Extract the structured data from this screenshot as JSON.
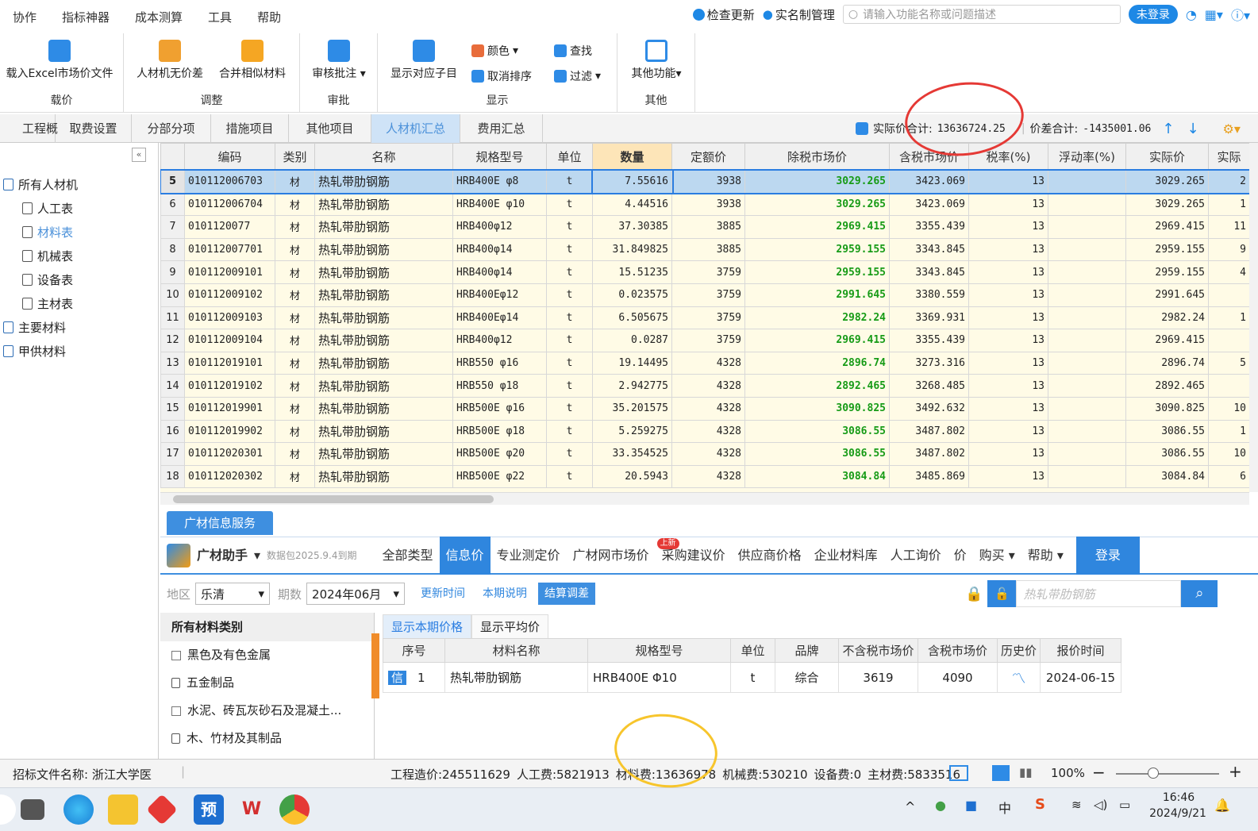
{
  "menu": {
    "items": [
      "协作",
      "指标神器",
      "成本测算",
      "工具",
      "帮助"
    ],
    "check_update": "检查更新",
    "realname": "实名制管理",
    "search_placeholder": "请输入功能名称或问题描述",
    "login_state": "未登录"
  },
  "ribbon": {
    "groups": [
      {
        "title": "载价",
        "buttons": [
          "载入Excel市场价文件"
        ]
      },
      {
        "title": "调整",
        "buttons": [
          "人材机无价差",
          "合并相似材料"
        ]
      },
      {
        "title": "审批",
        "buttons": [
          "审核批注"
        ]
      },
      {
        "title": "显示",
        "buttons": [
          "显示对应子目",
          "颜色",
          "取消排序",
          "查找",
          "过滤"
        ]
      },
      {
        "title": "其他",
        "buttons": [
          "其他功能"
        ]
      }
    ]
  },
  "tabs": [
    "工程概况",
    "取费设置",
    "分部分项",
    "措施项目",
    "其他项目",
    "人材机汇总",
    "费用汇总"
  ],
  "summary": {
    "actual_total_label": "实际价合计:",
    "actual_total": "13636724.25",
    "diff_label": "价差合计:",
    "diff_total": "-1435001.06"
  },
  "tree": {
    "root": "所有人材机",
    "children": [
      "人工表",
      "材料表",
      "机械表",
      "设备表",
      "主材表"
    ],
    "others": [
      "主要材料",
      "甲供材料"
    ]
  },
  "grid": {
    "headers": [
      "编码",
      "类别",
      "名称",
      "规格型号",
      "单位",
      "数量",
      "定额价",
      "除税市场价",
      "含税市场价",
      "税率(%)",
      "浮动率(%)",
      "实际价",
      "实际"
    ],
    "rows": [
      [
        "5",
        "010112006703",
        "材",
        "热轧带肋钢筋",
        "HRB400E φ8",
        "t",
        "7.55616",
        "3938",
        "3029.265",
        "3423.069",
        "13",
        "",
        "3029.265",
        "2"
      ],
      [
        "6",
        "010112006704",
        "材",
        "热轧带肋钢筋",
        "HRB400E φ10",
        "t",
        "4.44516",
        "3938",
        "3029.265",
        "3423.069",
        "13",
        "",
        "3029.265",
        "1"
      ],
      [
        "7",
        "0101120077",
        "材",
        "热轧带肋钢筋",
        "HRB400φ12",
        "t",
        "37.30385",
        "3885",
        "2969.415",
        "3355.439",
        "13",
        "",
        "2969.415",
        "11"
      ],
      [
        "8",
        "010112007701",
        "材",
        "热轧带肋钢筋",
        "HRB400φ14",
        "t",
        "31.849825",
        "3885",
        "2959.155",
        "3343.845",
        "13",
        "",
        "2959.155",
        "9"
      ],
      [
        "9",
        "010112009101",
        "材",
        "热轧带肋钢筋",
        "HRB400φ14",
        "t",
        "15.51235",
        "3759",
        "2959.155",
        "3343.845",
        "13",
        "",
        "2959.155",
        "4"
      ],
      [
        "10",
        "010112009102",
        "材",
        "热轧带肋钢筋",
        "HRB400Eφ12",
        "t",
        "0.023575",
        "3759",
        "2991.645",
        "3380.559",
        "13",
        "",
        "2991.645",
        ""
      ],
      [
        "11",
        "010112009103",
        "材",
        "热轧带肋钢筋",
        "HRB400Eφ14",
        "t",
        "6.505675",
        "3759",
        "2982.24",
        "3369.931",
        "13",
        "",
        "2982.24",
        "1"
      ],
      [
        "12",
        "010112009104",
        "材",
        "热轧带肋钢筋",
        "HRB400φ12",
        "t",
        "0.0287",
        "3759",
        "2969.415",
        "3355.439",
        "13",
        "",
        "2969.415",
        ""
      ],
      [
        "13",
        "010112019101",
        "材",
        "热轧带肋钢筋",
        "HRB550 φ16",
        "t",
        "19.14495",
        "4328",
        "2896.74",
        "3273.316",
        "13",
        "",
        "2896.74",
        "5"
      ],
      [
        "14",
        "010112019102",
        "材",
        "热轧带肋钢筋",
        "HRB550 φ18",
        "t",
        "2.942775",
        "4328",
        "2892.465",
        "3268.485",
        "13",
        "",
        "2892.465",
        ""
      ],
      [
        "15",
        "010112019901",
        "材",
        "热轧带肋钢筋",
        "HRB500E φ16",
        "t",
        "35.201575",
        "4328",
        "3090.825",
        "3492.632",
        "13",
        "",
        "3090.825",
        "10"
      ],
      [
        "16",
        "010112019902",
        "材",
        "热轧带肋钢筋",
        "HRB500E φ18",
        "t",
        "5.259275",
        "4328",
        "3086.55",
        "3487.802",
        "13",
        "",
        "3086.55",
        "1"
      ],
      [
        "17",
        "010112020301",
        "材",
        "热轧带肋钢筋",
        "HRB500E φ20",
        "t",
        "33.354525",
        "4328",
        "3086.55",
        "3487.802",
        "13",
        "",
        "3086.55",
        "10"
      ],
      [
        "18",
        "010112020302",
        "材",
        "热轧带肋钢筋",
        "HRB500E φ22",
        "t",
        "20.5943",
        "4328",
        "3084.84",
        "3485.869",
        "13",
        "",
        "3084.84",
        "6"
      ]
    ]
  },
  "gc": {
    "tab": "广材信息服务",
    "brand": "广材助手",
    "expiry": "数据包2025.9.4到期",
    "nav": [
      "全部类型",
      "信息价",
      "专业测定价",
      "广材网市场价",
      "采购建议价",
      "供应商价格",
      "企业材料库",
      "人工询价",
      "价",
      "购买",
      "帮助",
      "登录"
    ],
    "badge": "上新",
    "region_label": "地区",
    "region": "乐清",
    "period_label": "期数",
    "period": "2024年06月",
    "btns": [
      "更新时间",
      "本期说明",
      "结算调差"
    ],
    "search_placeholder": "热轧带肋钢筋",
    "cat_head": "所有材料类别",
    "cats": [
      "黑色及有色金属",
      "五金制品",
      "水泥、砖瓦灰砂石及混凝土...",
      "木、竹材及其制品"
    ],
    "ptabs": [
      "显示本期价格",
      "显示平均价"
    ],
    "price_headers": [
      "序号",
      "材料名称",
      "规格型号",
      "单位",
      "品牌",
      "不含税市场价",
      "含税市场价",
      "历史价",
      "报价时间"
    ],
    "price_rows": [
      {
        "tag": "信",
        "no": "1",
        "name": "热轧带肋钢筋",
        "spec": "HRB400E Φ10",
        "unit": "t",
        "brand": "综合",
        "ex": "3619",
        "inc": "4090",
        "date": "2024-06-15"
      }
    ]
  },
  "status": {
    "file": "招标文件名称: 浙江大学医",
    "cost": "工程造价:245511629",
    "labor": "人工费:5821913",
    "material": "材料费:13636978",
    "machine": "机械费:530210",
    "equip": "设备费:0",
    "main": "主材费:5833516",
    "zoom": "100%"
  },
  "taskbar": {
    "time": "16:46",
    "date": "2024/9/21",
    "ime": "中"
  }
}
